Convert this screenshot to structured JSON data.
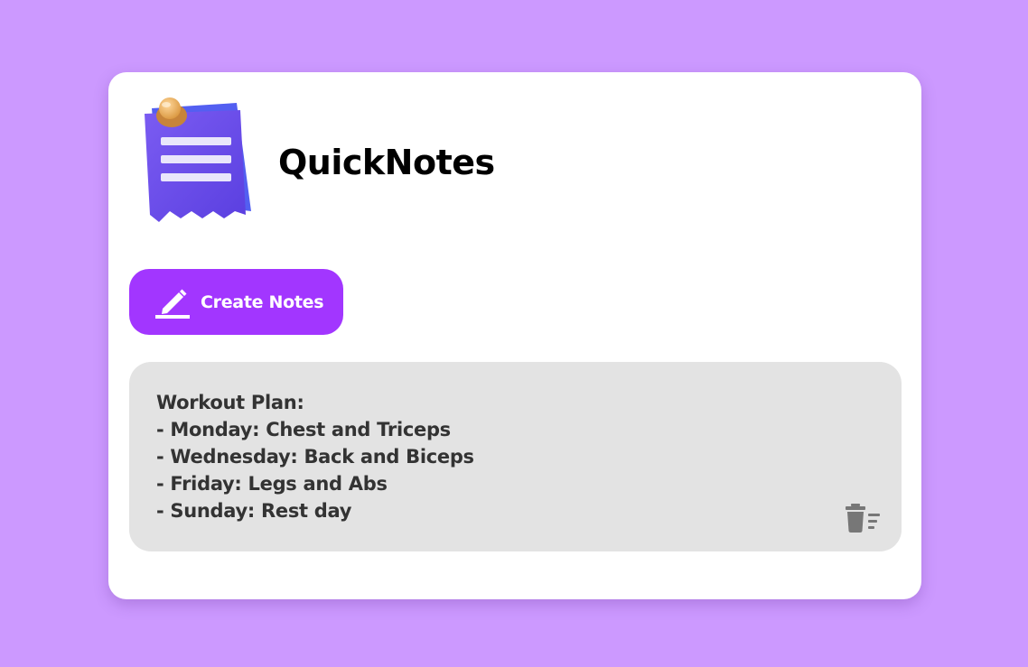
{
  "app": {
    "title": "QuickNotes",
    "logo_icon": "notepad-pin-icon"
  },
  "toolbar": {
    "create_label": "Create Notes",
    "create_icon": "pencil-edit-icon"
  },
  "notes": [
    {
      "lines": [
        "Workout Plan:",
        "- Monday: Chest and Triceps",
        "- Wednesday: Back and Biceps",
        "- Friday: Legs and Abs",
        "- Sunday: Rest day"
      ],
      "delete_icon": "trash-list-icon"
    }
  ],
  "colors": {
    "background": "#cc99ff",
    "card": "#ffffff",
    "accent": "#a236ff",
    "note_bg": "#e3e3e3",
    "note_text": "#333333",
    "icon_gray": "#777777"
  }
}
